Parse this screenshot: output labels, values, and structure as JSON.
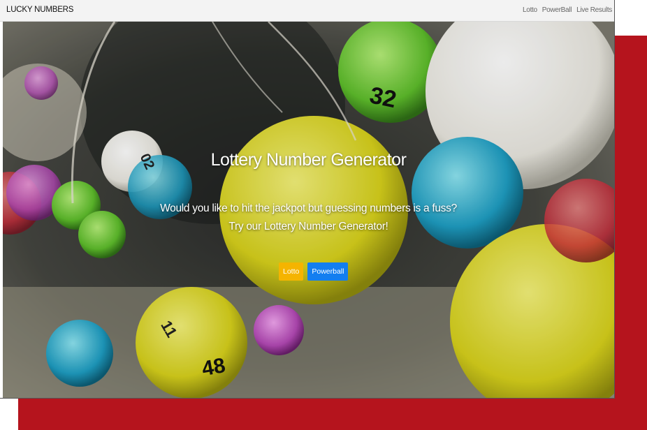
{
  "brand": "LUCKY NUMBERS",
  "nav": [
    "Lotto",
    "PowerBall",
    "Live Results"
  ],
  "hero": {
    "title": "Lottery Number Generator",
    "subtitle_line1": "Would you like to hit the jackpot but guessing numbers is a fuss?",
    "subtitle_line2": "Try our Lottery Number Generator!",
    "buttons": {
      "lotto": "Lotto",
      "powerball": "Powerball"
    }
  },
  "ball_numbers": [
    "32",
    "02",
    "48",
    "11"
  ],
  "colors": {
    "accent_red": "#b5141d",
    "lotto_button": "#f5b400",
    "powerball_button": "#137ef0"
  }
}
